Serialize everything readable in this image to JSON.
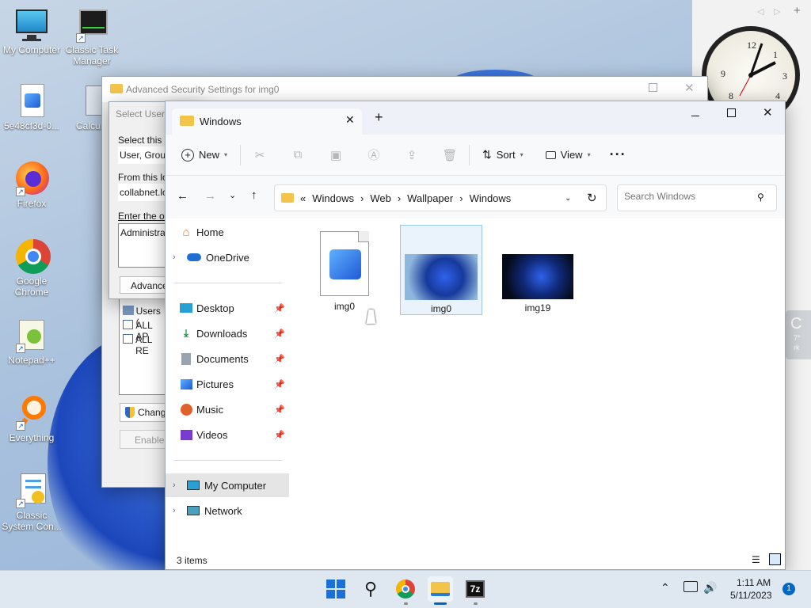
{
  "desktop": {
    "icons": [
      {
        "label": "My Computer"
      },
      {
        "label": "Classic Task Manager"
      },
      {
        "label": "5e48cf3d-0..."
      },
      {
        "label": "Calcula"
      },
      {
        "label": "Firefox"
      },
      {
        "label": "Google Chrome"
      },
      {
        "label": "Notepad++"
      },
      {
        "label": "Everything"
      },
      {
        "label": "Classic System Con..."
      }
    ]
  },
  "gadget": {
    "weather_partial": "C",
    "weather_small": "7°",
    "weather_small2": "rk"
  },
  "advanced_security": {
    "title": "Advanced Security Settings for img0",
    "list_items": [
      "Users (",
      "ALL AP",
      "ALL RE"
    ],
    "change_label": "Chang",
    "enable_label": "Enable"
  },
  "select_user": {
    "title": "Select User,",
    "select_label": "Select this ob",
    "object_type": "User, Group",
    "from_label": "From this loca",
    "location": "collabnet.loc",
    "enter_label": "Enter the obj",
    "enter_value": "Administrato",
    "advanced_label": "Advance"
  },
  "explorer": {
    "tab_title": "Windows",
    "toolbar": {
      "new_label": "New",
      "sort_label": "Sort",
      "view_label": "View"
    },
    "breadcrumb": [
      "Windows",
      "Web",
      "Wallpaper",
      "Windows"
    ],
    "search_placeholder": "Search Windows",
    "nav": {
      "home": "Home",
      "onedrive": "OneDrive",
      "desktop": "Desktop",
      "downloads": "Downloads",
      "documents": "Documents",
      "pictures": "Pictures",
      "music": "Music",
      "videos": "Videos",
      "my_computer": "My Computer",
      "network": "Network"
    },
    "files": [
      {
        "name": "img0"
      },
      {
        "name": "img0"
      },
      {
        "name": "img19"
      }
    ],
    "status": "3 items"
  },
  "taskbar": {
    "time": "1:11 AM",
    "date": "5/11/2023",
    "notification_count": "1",
    "sevenzip_label": "7z"
  },
  "colors": {
    "accent": "#0067c0",
    "selection": "#cce4f7"
  }
}
